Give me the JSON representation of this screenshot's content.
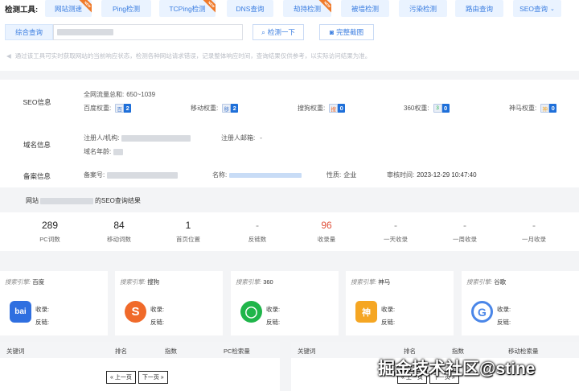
{
  "toolbar": {
    "label": "检测工具:",
    "tools": [
      {
        "label": "网站测速",
        "badge": "NEW"
      },
      {
        "label": "Ping检测",
        "badge": ""
      },
      {
        "label": "TCPing检测",
        "badge": "NEW"
      },
      {
        "label": "DNS查询",
        "badge": ""
      },
      {
        "label": "劫持检测",
        "badge": "NEW"
      },
      {
        "label": "被墙检测",
        "badge": ""
      },
      {
        "label": "污染检测",
        "badge": ""
      },
      {
        "label": "路由查询",
        "badge": ""
      },
      {
        "label": "SEO查询",
        "badge": ""
      }
    ]
  },
  "query": {
    "type_select": "综合查询",
    "input_value": "",
    "check_button": "检测一下",
    "screenshot_button": "完整截图"
  },
  "notice": "通过该工具可实时获取网站的当前响应状态，检测各种网站请求错误，记录整体响应时间，查询结果仅供参考，以实际访问结果为准。",
  "seo_info": {
    "label": "SEO信息",
    "traffic_label": "全网流量总和:",
    "traffic_value": "650~1039",
    "weights": [
      {
        "label": "百度权重:",
        "value": "2"
      },
      {
        "label": "移动权重:",
        "value": "2"
      },
      {
        "label": "搜狗权重:",
        "value": "0"
      },
      {
        "label": "360权重:",
        "value": "0"
      },
      {
        "label": "神马权重:",
        "value": "0"
      }
    ]
  },
  "domain_info": {
    "label": "域名信息",
    "registrant_label": "注册人/机构:",
    "email_label": "注册人邮箱:",
    "email_value": "-",
    "age_label": "域名年龄:"
  },
  "icp_info": {
    "label": "备案信息",
    "number_label": "备案号:",
    "name_label": "名称:",
    "nature_label": "性质:",
    "nature_value": "企业",
    "time_label": "审核时间:",
    "time_value": "2023-12-29 10:47:40"
  },
  "seo_result": {
    "prefix": "网站",
    "suffix": "的SEO查询结果"
  },
  "stats": [
    {
      "value": "289",
      "label": "PC词数"
    },
    {
      "value": "84",
      "label": "移动词数"
    },
    {
      "value": "1",
      "label": "首页位置"
    },
    {
      "value": "-",
      "label": "反链数"
    },
    {
      "value": "96",
      "label": "收录量"
    },
    {
      "value": "-",
      "label": "一天收录"
    },
    {
      "value": "-",
      "label": "一周收录"
    },
    {
      "value": "-",
      "label": "一月收录"
    }
  ],
  "engines": [
    {
      "prefix": "搜索引擎:",
      "name": "百度",
      "logo": "bai",
      "color": "#2f6fe0",
      "index_label": "收录:",
      "backlink_label": "反链:"
    },
    {
      "prefix": "搜索引擎:",
      "name": "搜狗",
      "logo": "S",
      "color": "#f06a2a",
      "index_label": "收录:",
      "backlink_label": "反链:"
    },
    {
      "prefix": "搜索引擎:",
      "name": "360",
      "logo": "◯",
      "color": "#1fb54a",
      "index_label": "收录:",
      "backlink_label": "反链:"
    },
    {
      "prefix": "搜索引擎:",
      "name": "神马",
      "logo": "神",
      "color": "#f5a623",
      "index_label": "收录:",
      "backlink_label": "反链:"
    },
    {
      "prefix": "搜索引擎:",
      "name": "谷歌",
      "logo": "G",
      "color": "#4a86e8",
      "index_label": "收录:",
      "backlink_label": "反链:"
    }
  ],
  "pc_table": {
    "headers": [
      "关键词",
      "排名",
      "指数",
      "PC检索量"
    ],
    "prev": "« 上一页",
    "next": "下一页 »"
  },
  "mobile_table": {
    "headers": [
      "关键词",
      "排名",
      "指数",
      "移动检索量"
    ],
    "prev": "« 上一页",
    "next": "下一页 »"
  },
  "watermark": "掘金技术社区@stine"
}
